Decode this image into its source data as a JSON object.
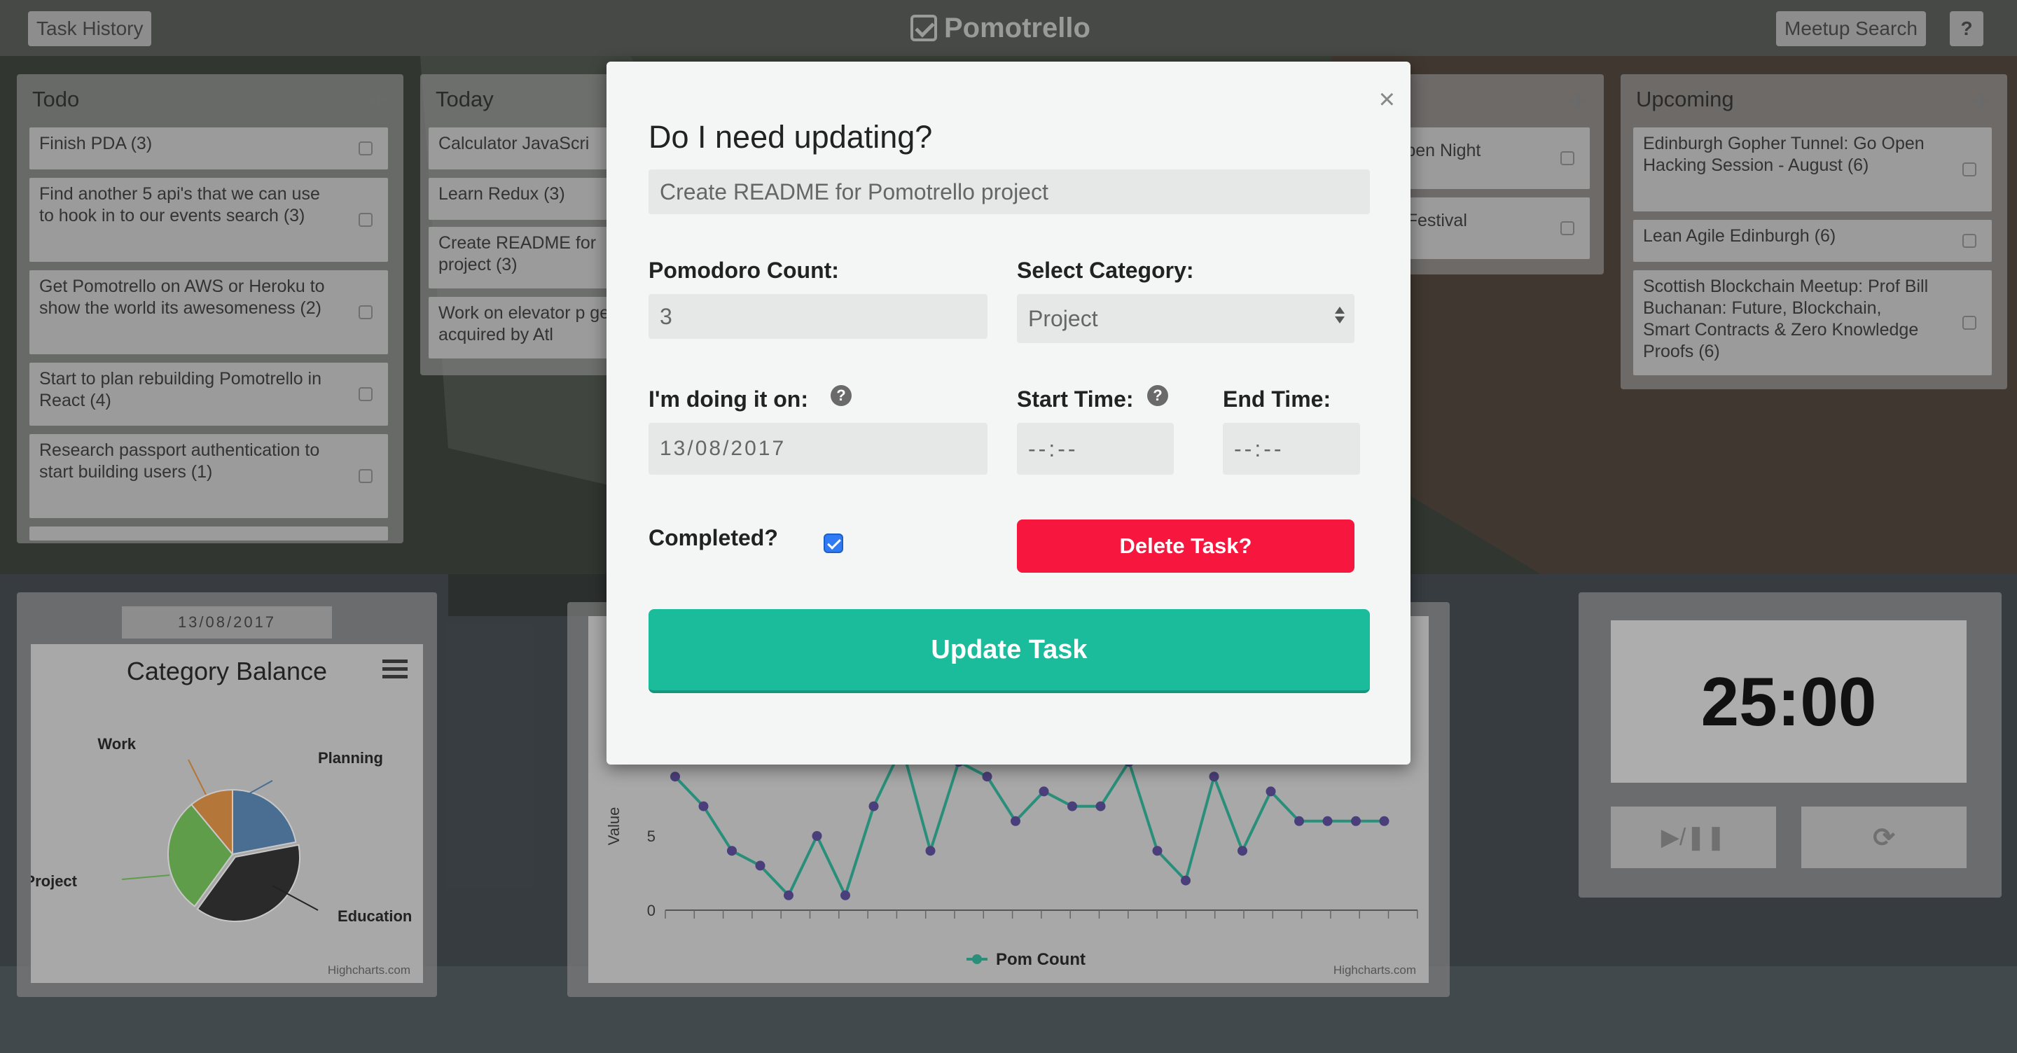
{
  "topbar": {
    "task_history": "Task History",
    "brand": "Pomotrello",
    "meetup_search": "Meetup Search",
    "help": "?"
  },
  "lists": {
    "todo": {
      "title": "Todo",
      "cards": [
        "Finish PDA (3)",
        "Find another 5 api's that we can use to hook in to our events search (3)",
        "Get Pomotrello on AWS or Heroku to show the world its awesomeness (2)",
        "Start to plan rebuilding Pomotrello in React (4)",
        "Research passport authentication to start building users (1)"
      ]
    },
    "today": {
      "title": "Today",
      "cards": [
        "Calculator JavaScri",
        "Learn Redux (3)",
        "Create README for project (3)",
        "Work on elevator p get acquired by Atl"
      ]
    },
    "week": {
      "cards": [
        ": Open Night",
        "gh Festival"
      ]
    },
    "upcoming": {
      "title": "Upcoming",
      "cards": [
        "Edinburgh Gopher Tunnel: Go Open Hacking Session - August (6)",
        "Lean Agile Edinburgh (6)",
        "Scottish Blockchain Meetup: Prof Bill Buchanan: Future, Blockchain, Smart Contracts & Zero Knowledge Proofs (6)"
      ]
    }
  },
  "pie_panel": {
    "date": "13/08/2017",
    "credit": "Highcharts.com"
  },
  "line_panel": {
    "credit": "Highcharts.com"
  },
  "timer": {
    "time": "25:00",
    "play_pause": "▶/❚❚",
    "reset": "⟳"
  },
  "chart_data": [
    {
      "type": "pie",
      "title": "Category Balance",
      "slices": [
        {
          "label": "Planning",
          "value": 22,
          "color": "#4a6d92"
        },
        {
          "label": "Education",
          "value": 38,
          "color": "#2a2a2a"
        },
        {
          "label": "Project",
          "value": 29,
          "color": "#5f9d4a"
        },
        {
          "label": "Work",
          "value": 11,
          "color": "#b5763a"
        }
      ]
    },
    {
      "type": "line",
      "ylabel": "Value",
      "y_ticks": [
        "0",
        "5"
      ],
      "ylim": [
        0,
        8
      ],
      "series": [
        {
          "name": "Pom Count",
          "color": "#2a8f7a",
          "marker_color": "#4a3f7a",
          "values": [
            9,
            7,
            4,
            3,
            1,
            5,
            1,
            7,
            11,
            4,
            10,
            9,
            6,
            8,
            7,
            7,
            10,
            4,
            2,
            9,
            4,
            8,
            6,
            6,
            6,
            6
          ]
        }
      ]
    }
  ],
  "modal": {
    "close": "×",
    "title": "Do I need updating?",
    "task_name": "Create README for Pomotrello project",
    "pomodoro_label": "Pomodoro Count:",
    "pomodoro_value": "3",
    "category_label": "Select Category:",
    "category_value": "Project",
    "date_label": "I'm doing it on:",
    "date_value": "13/08/2017",
    "start_label": "Start Time:",
    "start_value": "--:--",
    "end_label": "End Time:",
    "end_value": "--:--",
    "completed_label": "Completed?",
    "delete_label": "Delete Task?",
    "update_label": "Update Task",
    "help": "?"
  },
  "colors": {
    "accent": "#1bbc9c",
    "danger": "#f6163e",
    "checkbox": "#2f7bf5"
  }
}
